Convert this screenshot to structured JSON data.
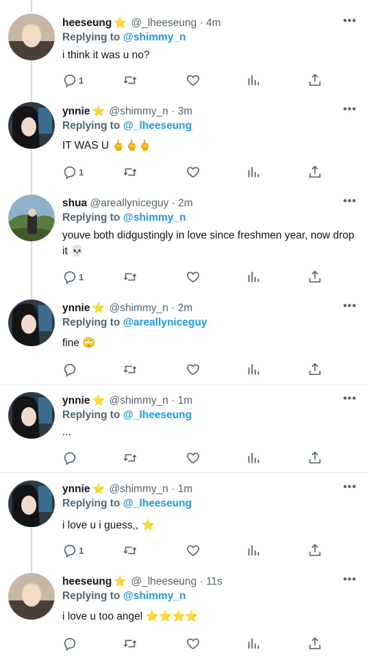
{
  "tweets": [
    {
      "name": "heeseung",
      "handle": "@_lheeseung",
      "time": "4m",
      "replying_label": "Replying to",
      "replying_to": "@shimmy_n",
      "text": "i think it was u no?",
      "reply_count": "1",
      "avatar": "male-portrait"
    },
    {
      "name": "ynnie",
      "handle": "@shimmy_n",
      "time": "3m",
      "replying_label": "Replying to",
      "replying_to": "@_lheeseung",
      "text": "IT WAS U 🖕🖕🖕",
      "reply_count": "1",
      "avatar": "female-portrait"
    },
    {
      "name": "shua",
      "handle": "@areallyniceguy",
      "time": "2m",
      "replying_label": "Replying to",
      "replying_to": "@shimmy_n",
      "text": "youve both didgustingly in love since freshmen year, now drop it 💀",
      "reply_count": "1",
      "avatar": "outdoor-portrait"
    },
    {
      "name": "ynnie",
      "handle": "@shimmy_n",
      "time": "2m",
      "replying_label": "Replying to",
      "replying_to": "@areallyniceguy",
      "text": "fine 🙄",
      "reply_count": "",
      "avatar": "female-portrait"
    },
    {
      "name": "ynnie",
      "handle": "@shimmy_n",
      "time": "1m",
      "replying_label": "Replying to",
      "replying_to": "@_lheeseung",
      "text": "...",
      "reply_count": "",
      "avatar": "female-portrait"
    },
    {
      "name": "ynnie",
      "handle": "@shimmy_n",
      "time": "1m",
      "replying_label": "Replying to",
      "replying_to": "@_lheeseung",
      "text": "i love u i guess,, ⭐",
      "reply_count": "1",
      "avatar": "female-portrait"
    },
    {
      "name": "heeseung",
      "handle": "@_lheeseung",
      "time": "11s",
      "replying_label": "Replying to",
      "replying_to": "@shimmy_n",
      "text": "i love u too angel ⭐⭐⭐⭐",
      "reply_count": "",
      "avatar": "male-portrait"
    }
  ],
  "colors": {
    "accent": "#1d9bf0",
    "muted": "#536471",
    "star": "#f5c13b"
  },
  "icons": [
    "reply-icon",
    "retweet-icon",
    "like-icon",
    "stats-icon",
    "share-icon",
    "more-icon",
    "verified-star-icon"
  ]
}
